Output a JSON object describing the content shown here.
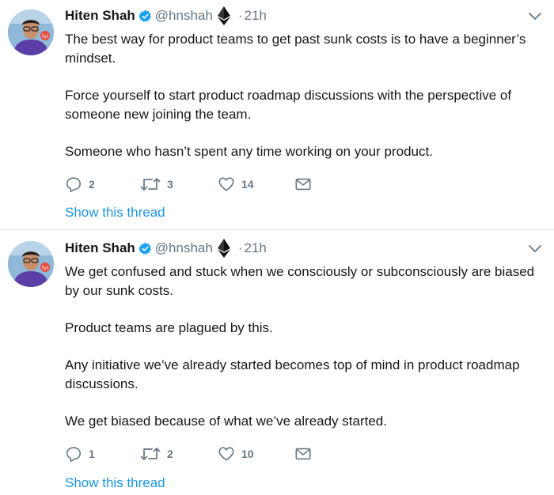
{
  "colors": {
    "link": "#1b95e0",
    "verified": "#1da1f2",
    "muted": "#657786",
    "divider": "#e6ecf0"
  },
  "tweets": [
    {
      "author": {
        "name": "Hiten Shah",
        "handle": "@hnshah",
        "verified_icon": "verified-badge-icon",
        "emoji_icon": "ethereum-icon"
      },
      "separator": "·",
      "time": "21h",
      "paragraphs": [
        "The best way for product teams to get past sunk costs is to have a beginner’s mindset.",
        "Force yourself to start product roadmap discussions with the perspective of someone new joining the team.",
        "Someone who hasn’t spent any time working on your product."
      ],
      "actions": {
        "replies": "2",
        "retweets": "3",
        "likes": "14"
      },
      "show_thread": "Show this thread"
    },
    {
      "author": {
        "name": "Hiten Shah",
        "handle": "@hnshah",
        "verified_icon": "verified-badge-icon",
        "emoji_icon": "ethereum-icon"
      },
      "separator": "·",
      "time": "21h",
      "paragraphs": [
        "We get confused and stuck when we consciously or subconsciously are biased by our sunk costs.",
        "Product teams are plagued by this.",
        "Any initiative we’ve already started becomes top of mind in product roadmap discussions.",
        "We get biased because of what we’ve already started."
      ],
      "actions": {
        "replies": "1",
        "retweets": "2",
        "likes": "10"
      },
      "show_thread": "Show this thread"
    }
  ]
}
